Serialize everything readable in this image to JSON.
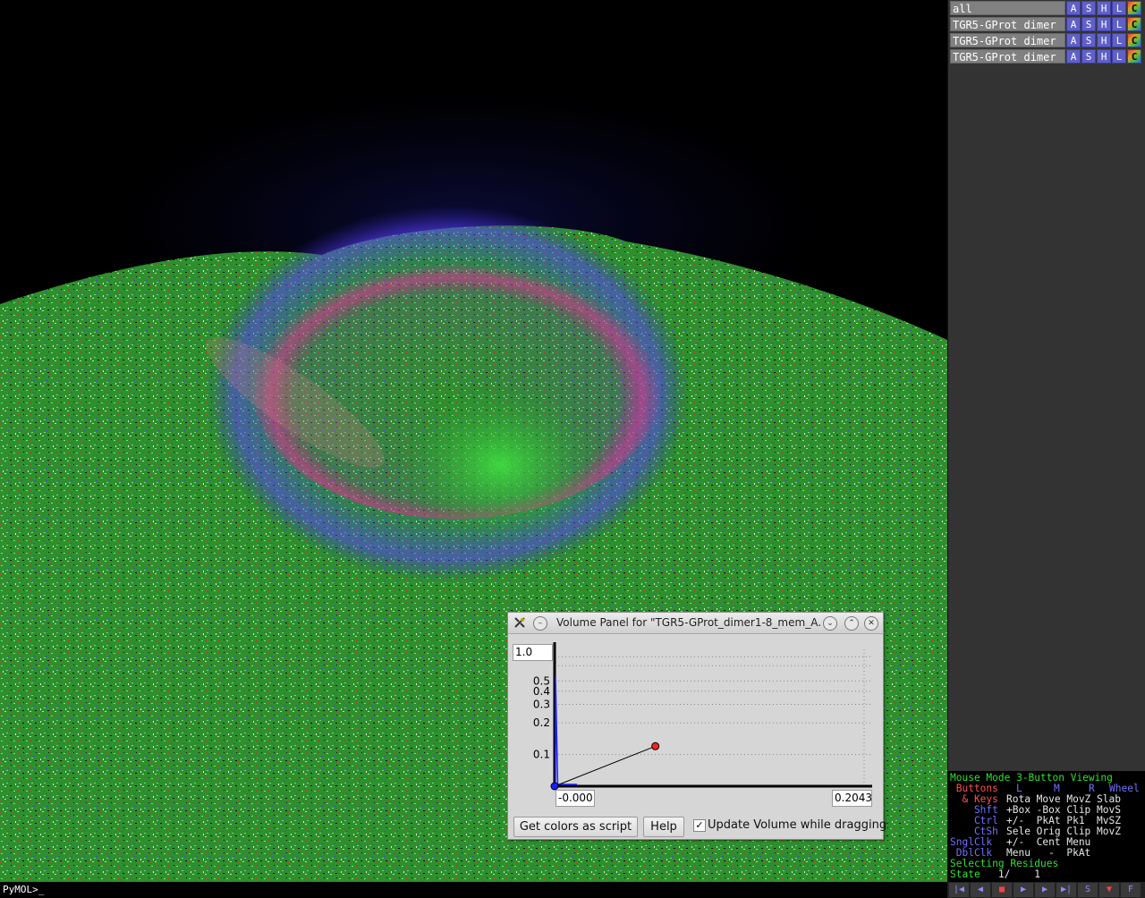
{
  "viewer": {
    "background_color": "#000000"
  },
  "command_line": {
    "prompt": "PyMOL>_"
  },
  "object_panel": {
    "objects": [
      {
        "name": "all",
        "buttons": [
          "A",
          "S",
          "H",
          "L",
          "C"
        ]
      },
      {
        "name": "TGR5-GProt_dimer",
        "buttons": [
          "A",
          "S",
          "H",
          "L",
          "C"
        ]
      },
      {
        "name": "TGR5-GProt_dimer",
        "buttons": [
          "A",
          "S",
          "H",
          "L",
          "C"
        ]
      },
      {
        "name": "TGR5-GProt_dimer",
        "buttons": [
          "A",
          "S",
          "H",
          "L",
          "C"
        ]
      }
    ]
  },
  "mouse_panel": {
    "line1": "Mouse Mode 3-Button Viewing",
    "buttons_label": " Buttons",
    "btn_l": "L",
    "btn_m": "M",
    "btn_r": "R",
    "btn_wheel": "Wheel",
    "keys_label": "  & Keys",
    "row_keys": "Rota Move MovZ Slab",
    "shft_label": "    Shft",
    "row_shft": "+Box -Box Clip MovS",
    "ctrl_label": "    Ctrl",
    "row_ctrl": "+/-  PkAt Pk1  MvSZ",
    "ctsh_label": "    CtSh",
    "row_ctsh": "Sele Orig Clip MovZ",
    "sngl_label": "SnglClk",
    "row_sngl": "+/-  Cent Menu",
    "dbl_label": " DblClk",
    "row_dbl": "Menu   -  PkAt",
    "selecting": "Selecting Residues",
    "state_label": "State",
    "state_value": "   1/    1"
  },
  "movie_controls": {
    "icons": [
      "first-frame-icon",
      "prev-frame-icon",
      "stop-icon",
      "play-icon",
      "next-frame-icon",
      "last-frame-icon",
      "scene-icon",
      "menu-icon",
      "fullscreen-icon"
    ],
    "glyphs": [
      "|◀",
      "◀",
      "■",
      "▶",
      "▶",
      "▶|",
      "S",
      "▼",
      "F"
    ]
  },
  "volume_panel": {
    "title": "Volume Panel for \"TGR5-GProt_dimer1-8_mem_A...",
    "max_value": "1.0",
    "min_x": "-0.000",
    "max_x": "0.2043",
    "get_colors_button": "Get colors as script",
    "help_button": "Help",
    "update_checkbox_label": "Update Volume while dragging",
    "update_checked": true,
    "checkmark": "✓",
    "colors": {
      "blue_point": "#1c1cff",
      "red_point": "#ff2020"
    },
    "chart_data": {
      "type": "line",
      "yticks": [
        "0.5",
        "0.4",
        "0.3",
        "0.2",
        "0.1"
      ],
      "ytick_values": [
        0.5,
        0.4,
        0.3,
        0.2,
        0.1
      ],
      "scale": "log",
      "xlim": [
        -0.0,
        0.2043
      ],
      "points": [
        {
          "x": 0.0,
          "y": 0.0,
          "color": "#1c1cff"
        },
        {
          "x": 0.0652,
          "y": 0.12,
          "color": "#ff2020"
        }
      ],
      "histogram_peak_x": 0.002,
      "grid": true
    }
  }
}
